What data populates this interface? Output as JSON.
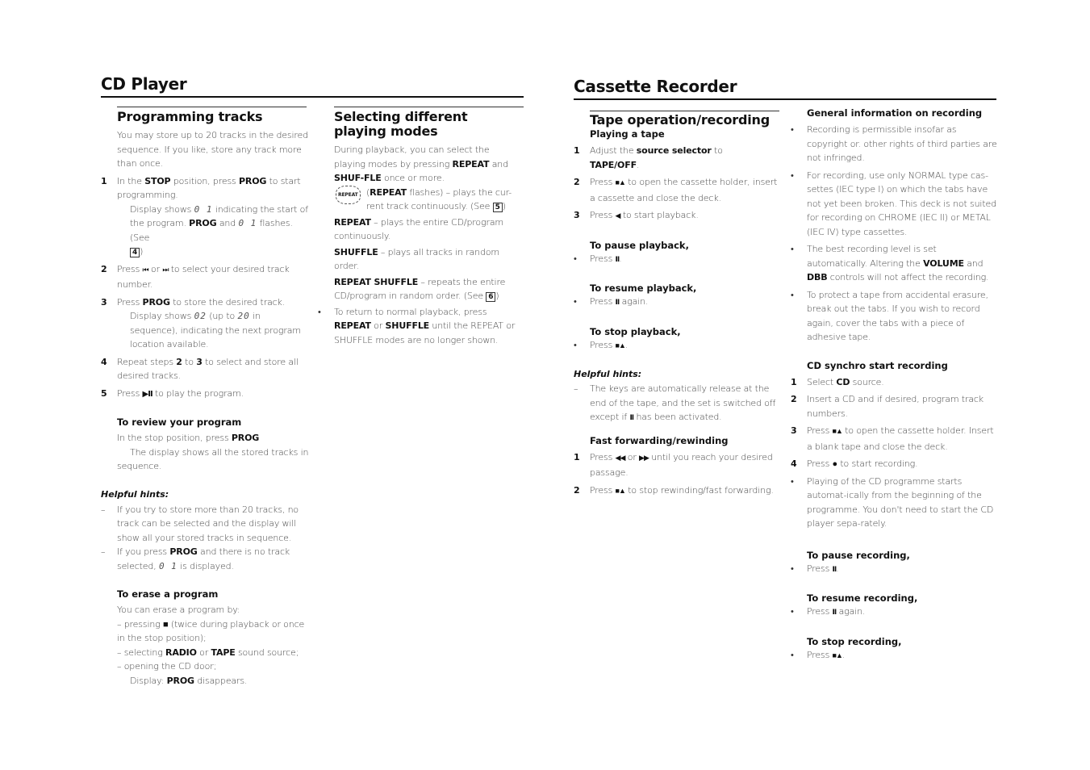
{
  "cd_player": {
    "title": "CD Player",
    "programming": {
      "heading": "Programming tracks",
      "intro": "You may store up to 20 tracks in the desired sequence. If you like, store any track more than once.",
      "steps": [
        {
          "num": "1",
          "a": "In the ",
          "b1": "STOP",
          "c": " position, press ",
          "b2": "PROG",
          "d": " to start programming."
        },
        {
          "num": "2",
          "text_pre": "Press ",
          "sym1": "⏮",
          "mid": " or ",
          "sym2": "⏭",
          "text_post": " to select your desired track number."
        },
        {
          "num": "3",
          "pre": "Press ",
          "b": "PROG",
          "post": " to store the desired track."
        },
        {
          "num": "4",
          "pre": "Repeat steps ",
          "b1": "2",
          "mid": " to ",
          "b2": "3",
          "post": " to select and store all desired tracks."
        },
        {
          "num": "5",
          "pre": "Press ",
          "sym": "▶II",
          "post": " to play the program."
        }
      ],
      "step1_display": {
        "pre": "Display shows ",
        "seg": "0 1",
        "mid": " indicating the start of the program. ",
        "b": "PROG",
        "and": " and ",
        "seg2": "0 1",
        "post": " flashes. (See ",
        "box": "4",
        "close": ")"
      },
      "step3_display": {
        "pre": "Display shows ",
        "seg": "02",
        "mid": " (up to ",
        "seg2": "20",
        "post": " in sequence), indicating the next program location available."
      }
    },
    "review": {
      "heading": "To review your program",
      "line1_pre": "In the stop position, press ",
      "line1_b": "PROG",
      "line2": "The display shows all the stored tracks in sequence."
    },
    "hints": {
      "title": "Helpful hints:",
      "items": [
        {
          "dash": "–",
          "text": "If you try to store more than 20 tracks, no track can be selected and the display will show all your stored tracks in sequence."
        },
        {
          "dash": "–",
          "pre": "If you press ",
          "b": "PROG",
          "mid": " and there is no track selected, ",
          "seg": "0 1",
          "post": " is displayed."
        }
      ]
    },
    "erase": {
      "heading": "To erase a program",
      "intro": "You can erase a program by:",
      "l1_pre": "– pressing ",
      "l1_sym": "■",
      "l1_post": " (twice during playback or once in the stop position);",
      "l2_pre": "– selecting ",
      "l2_b1": "RADIO",
      "l2_mid": " or ",
      "l2_b2": "TAPE",
      "l2_post": " sound source;",
      "l3": "– opening the CD door;",
      "l4_pre": "Display: ",
      "l4_b": "PROG",
      "l4_post": " disappears."
    },
    "modes": {
      "heading": "Selecting different playing modes",
      "intro_pre": "During playback, you can select the playing modes by pressing ",
      "intro_b1": "REPEAT",
      "intro_mid": " and ",
      "intro_b2": "SHUF-FLE",
      "intro_post": " once or more.",
      "repeat_icon": "REPEAT",
      "r1_open": "(",
      "r1_b": "REPEAT",
      "r1_post": " flashes) – plays the cur-rent track continuously. (See ",
      "r1_box": "5",
      "r1_close": ")",
      "r2_b": "REPEAT",
      "r2_post": " – plays the entire CD/program continuously.",
      "r3_b": "SHUFFLE",
      "r3_post": " – plays all tracks in random order.",
      "r4_b": "REPEAT SHUFFLE",
      "r4_post": " – repeats the entire CD/program in random order. (See ",
      "r4_box": "6",
      "r4_close": ")",
      "bullet": "•",
      "r5_pre": "To return to normal playback, press ",
      "r5_b1": "REPEAT",
      "r5_mid": " or ",
      "r5_b2": "SHUFFLE",
      "r5_post": " until the REPEAT or SHUFFLE modes are no longer shown."
    }
  },
  "cassette": {
    "title": "Cassette Recorder",
    "tape": {
      "heading": "Tape operation/recording",
      "subheading": "Playing a tape",
      "s1_pre": "Adjust the ",
      "s1_b": "source selector",
      "s1_mid": " to ",
      "s1_b2": "TAPE/OFF",
      "s1_post": ".",
      "s2_pre": "Press ",
      "s2_sym": "■▲",
      "s2_post": " to open the cassette holder, insert a cassette and close the deck.",
      "s3_pre": "Press ",
      "s3_sym": "◀",
      "s3_post": " to start playback.",
      "pause_h": "To pause playback,",
      "pause_pre": "Press ",
      "pause_sym": "II",
      "pause_post": ".",
      "resume_h": "To resume playback,",
      "resume_pre": "Press ",
      "resume_sym": "II",
      "resume_post": " again.",
      "stop_h": "To stop playback,",
      "stop_pre": "Press ",
      "stop_sym": "■▲",
      "stop_post": ".",
      "hints_title": "Helpful hints:",
      "hint_pre": "The keys are automatically release at the end of the tape, and the set is switched off except if ",
      "hint_sym": "II",
      "hint_post": " has been activated.",
      "ff_h": "Fast forwarding/rewinding",
      "ff1_pre": "Press ",
      "ff1_sym1": "◀◀",
      "ff1_mid": " or ",
      "ff1_sym2": "▶▶",
      "ff1_post": " until you reach your desired passage.",
      "ff2_pre": "Press ",
      "ff2_sym": "■▲",
      "ff2_post": " to stop rewinding/fast forwarding."
    },
    "general": {
      "heading": "General information on recording",
      "items": [
        "Recording is permissible insofar as copyright or. other rights of third parties are not infringed.",
        "For recording, use only NORMAL type cas-settes (IEC type I) on which the tabs have not yet been broken. This deck is not suited for recording on CHROME (IEC II) or METAL (IEC IV) type cassettes."
      ],
      "item3_pre": "The best recording level is set automatically. Altering the ",
      "item3_b1": "VOLUME",
      "item3_mid": " and ",
      "item3_b2": "DBB",
      "item3_post": " controls will not affect the recording.",
      "item4": "To protect a tape from accidental erasure, break out the tabs. If you wish to record again, cover the tabs with a piece of adhesive tape."
    },
    "synchro": {
      "heading": "CD synchro start recording",
      "s1_pre": "Select ",
      "s1_b": "CD",
      "s1_post": " source.",
      "s2": "Insert a CD and if desired, program track numbers.",
      "s3_pre": "Press ",
      "s3_sym": "■▲",
      "s3_post": " to open the cassette holder. Insert a blank tape and close the deck.",
      "s4_pre": "Press ",
      "s4_sym": "●",
      "s4_post": " to start recording.",
      "note": "Playing of the CD programme starts automat-ically from the beginning of the programme. You don't need to start the CD player sepa-rately.",
      "pause_h": "To pause recording,",
      "pause_pre": "Press ",
      "pause_sym": "II",
      "pause_post": ".",
      "resume_h": "To resume recording,",
      "resume_pre": "Press ",
      "resume_sym": "II",
      "resume_post": "  again.",
      "stop_h": "To stop recording,",
      "stop_pre": "Press ",
      "stop_sym": "■▲",
      "stop_post": "."
    }
  }
}
